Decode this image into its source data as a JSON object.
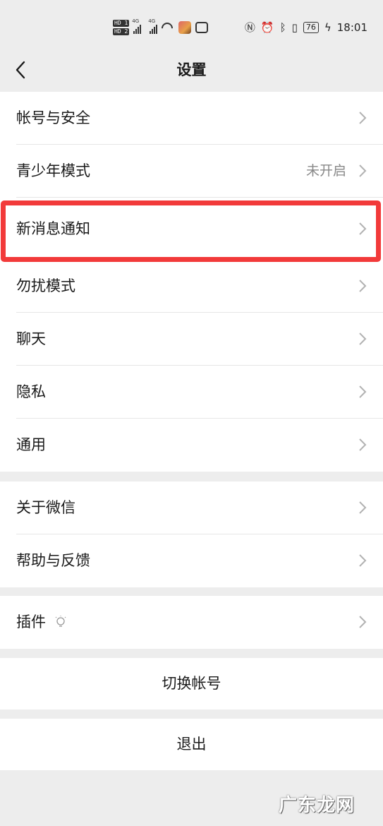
{
  "status_bar": {
    "hd1": "HD 1",
    "hd2": "HD 2",
    "net1": "4G",
    "net2": "4G",
    "battery": "76",
    "time": "18:01"
  },
  "header": {
    "title": "设置"
  },
  "groups": [
    {
      "items": [
        {
          "label": "帐号与安全",
          "value": ""
        },
        {
          "label": "青少年模式",
          "value": "未开启"
        },
        {
          "label": "新消息通知",
          "value": ""
        },
        {
          "label": "勿扰模式",
          "value": ""
        },
        {
          "label": "聊天",
          "value": ""
        },
        {
          "label": "隐私",
          "value": ""
        },
        {
          "label": "通用",
          "value": ""
        }
      ]
    },
    {
      "items": [
        {
          "label": "关于微信",
          "value": ""
        },
        {
          "label": "帮助与反馈",
          "value": ""
        }
      ]
    },
    {
      "items": [
        {
          "label": "插件",
          "value": ""
        }
      ]
    }
  ],
  "actions": {
    "switch_account": "切换帐号",
    "logout": "退出"
  },
  "watermark": "广东龙网",
  "colors": {
    "background": "#ededed",
    "highlight": "#f23a3a",
    "secondary_text": "#888888"
  }
}
